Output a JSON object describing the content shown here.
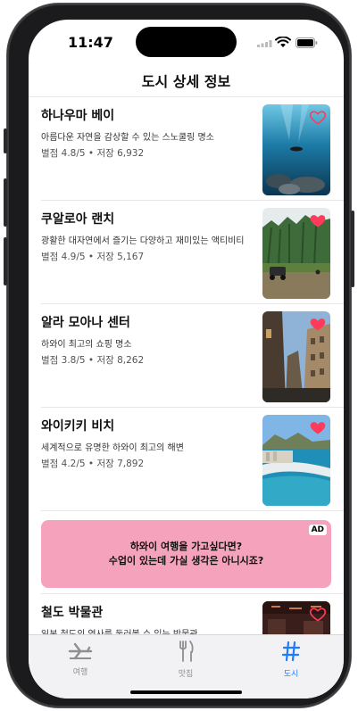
{
  "status_bar": {
    "time": "11:47"
  },
  "nav": {
    "title": "도시 상세 정보"
  },
  "items": [
    {
      "title": "하나우마 베이",
      "description": "아름다운 자연을 감상할 수 있는 스노쿨링 명소",
      "meta": "별점 4.8/5 • 저장 6,932",
      "favorited": false,
      "image_icon": "underwater-snorkel-photo"
    },
    {
      "title": "쿠알로아 랜치",
      "description": "광활한 대자연에서 즐기는 다양하고 재미있는 액티비티",
      "meta": "별점 4.9/5 • 저장 5,167",
      "favorited": true,
      "image_icon": "ranch-mountain-photo"
    },
    {
      "title": "알라 모아나 센터",
      "description": "하와이 최고의 쇼핑 명소",
      "meta": "별점 3.8/5 • 저장 8,262",
      "favorited": true,
      "image_icon": "street-buildings-photo"
    },
    {
      "title": "와이키키 비치",
      "description": "세계적으로 유명한 하와이 최고의 해변",
      "meta": "별점 4.2/5 • 저장 7,892",
      "favorited": true,
      "image_icon": "beach-coastline-photo"
    },
    {
      "title": "철도 박물관",
      "description": "일본 철도의 역사를 둘러볼 수 있는 박물관",
      "meta": "",
      "favorited": false,
      "image_icon": "museum-photo"
    }
  ],
  "ad": {
    "badge": "AD",
    "line1": "하와이 여행을 가고싶다면?",
    "line2": "수업이 있는데 가실 생각은 아니시죠?",
    "background": "#f5a3bc"
  },
  "tabbar": {
    "tabs": [
      {
        "label": "여행",
        "icon": "airplane-icon",
        "active": false
      },
      {
        "label": "맛집",
        "icon": "fork-knife-icon",
        "active": false
      },
      {
        "label": "도시",
        "icon": "hashtag-icon",
        "active": true
      }
    ]
  },
  "colors": {
    "accent": "#1f7cff",
    "heart": "#ff3b5c"
  }
}
